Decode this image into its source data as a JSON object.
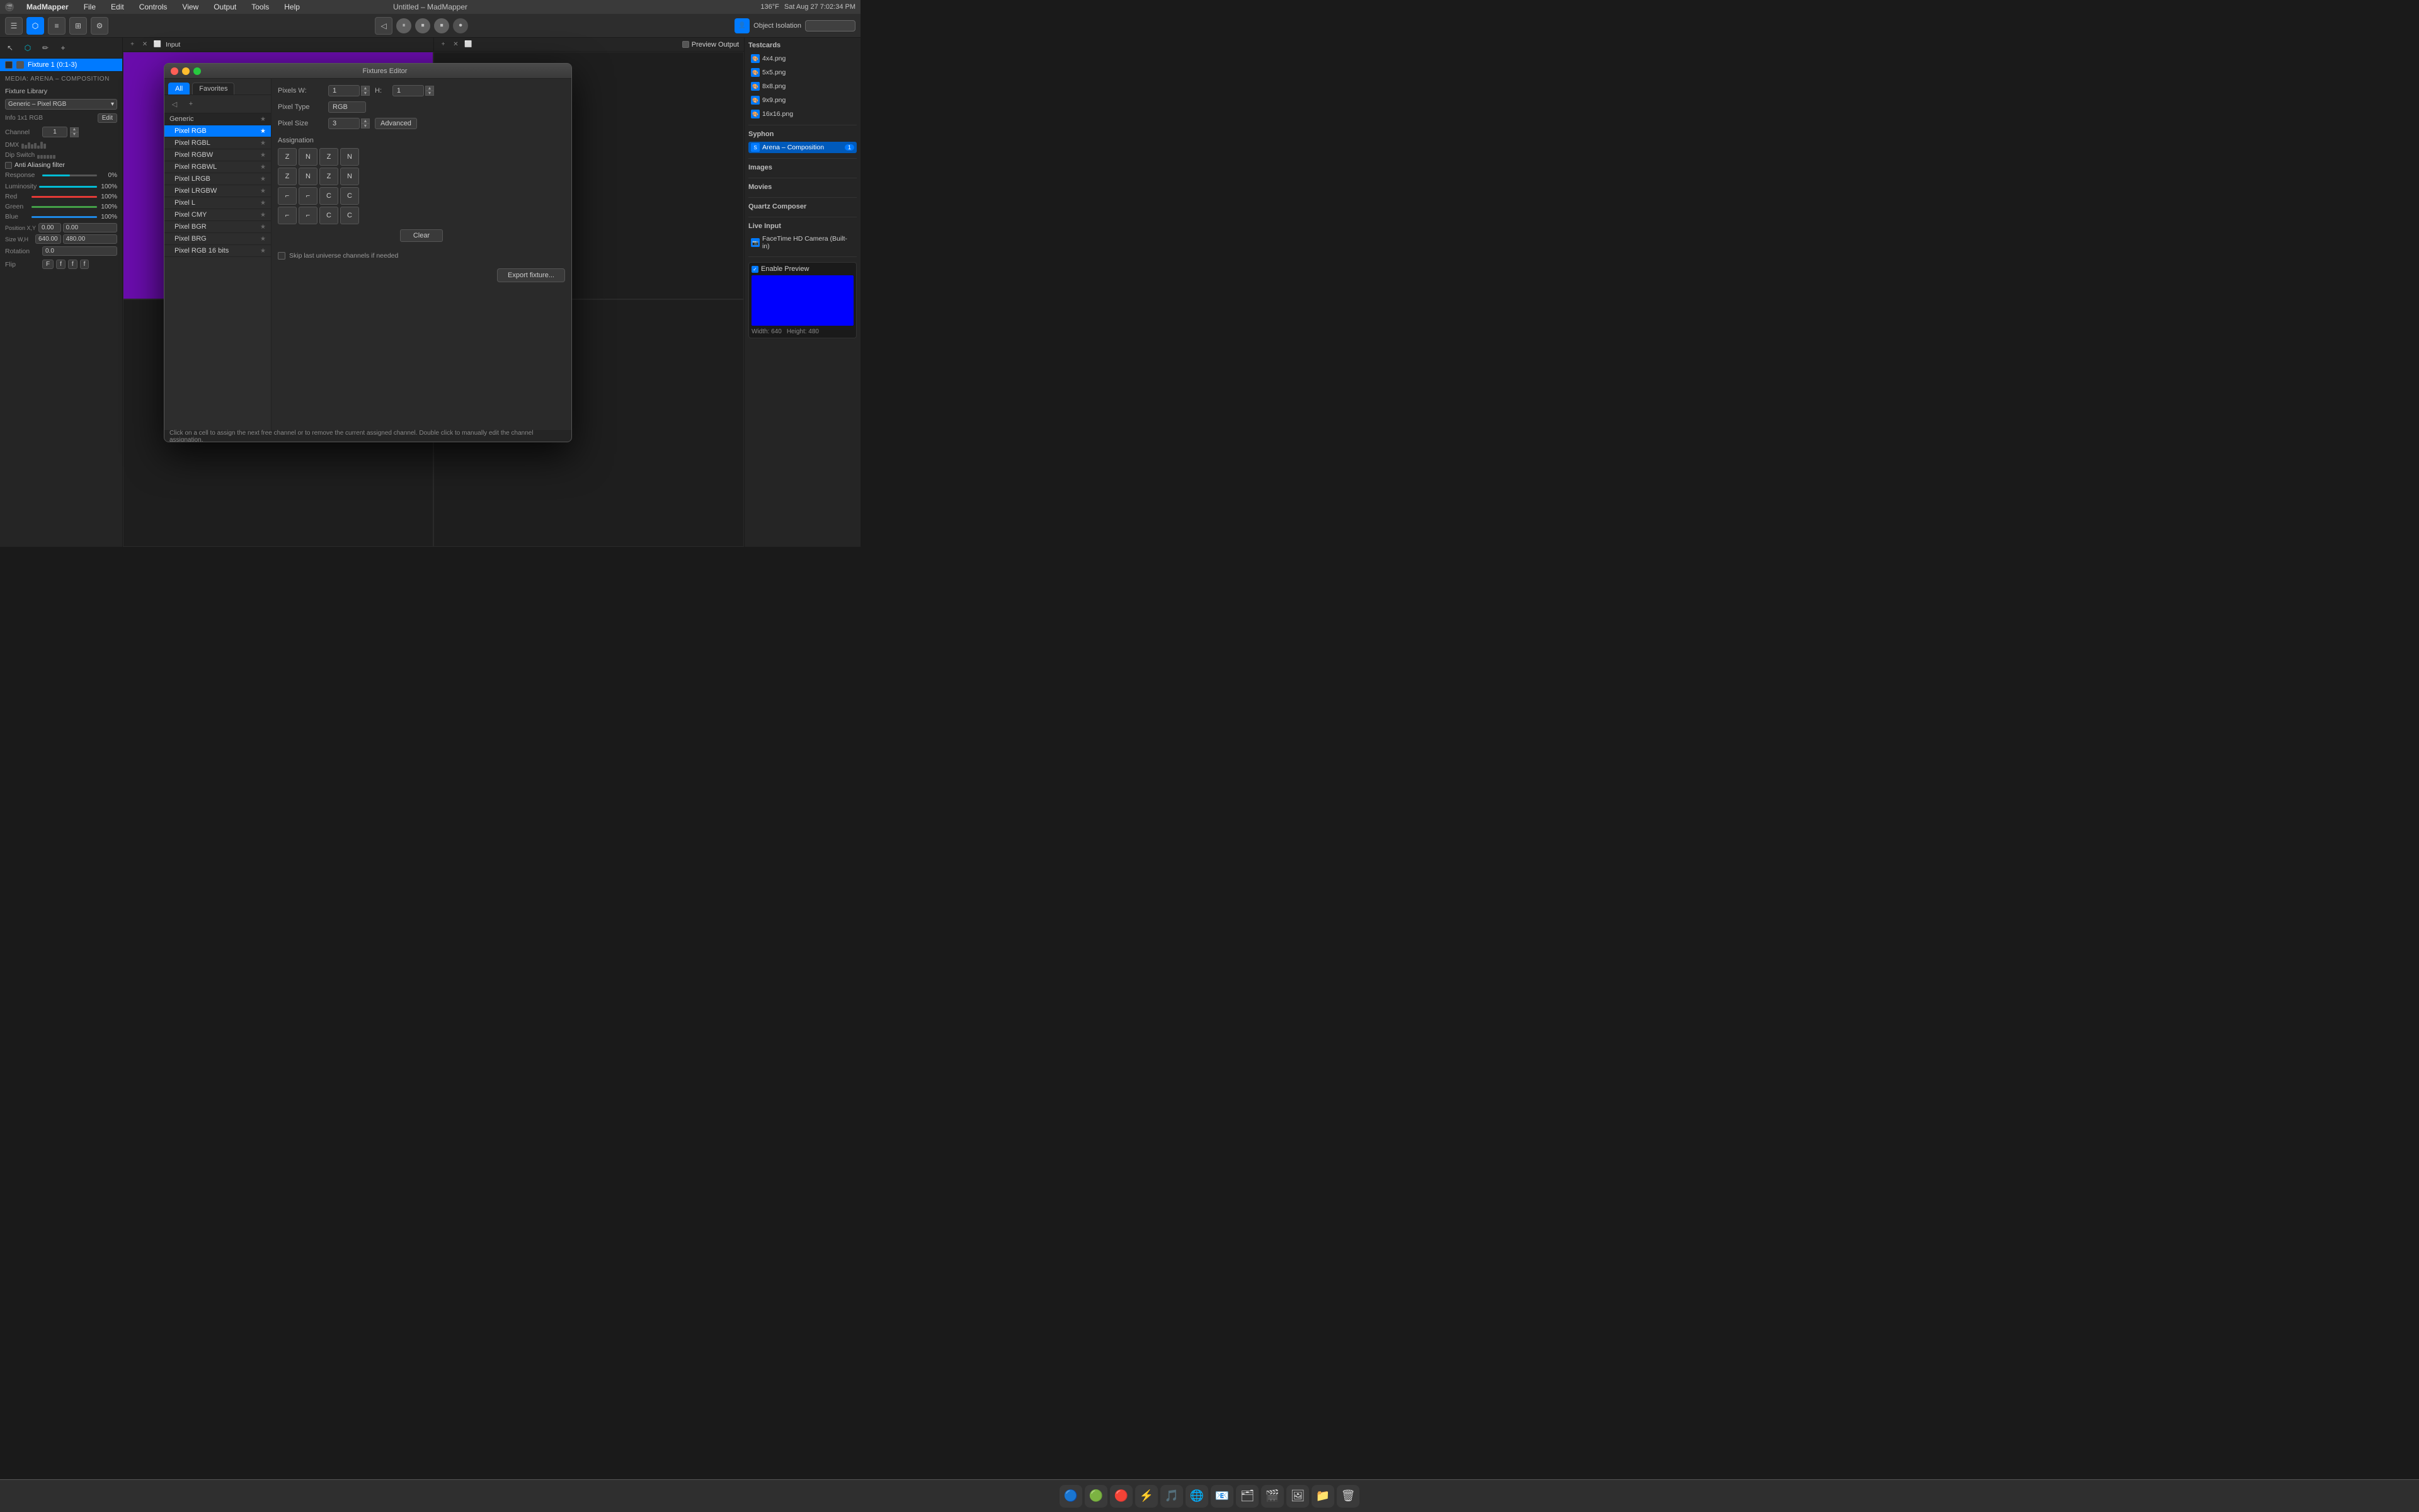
{
  "app": {
    "name": "MadMapper",
    "title": "Untitled – MadMapper",
    "version": "MadMapper"
  },
  "menubar": {
    "items": [
      "File",
      "Edit",
      "Controls",
      "View",
      "Output",
      "Tools",
      "Help"
    ],
    "clock": "Sat Aug 27  7:02:34 PM",
    "temp": "136°F"
  },
  "toolbar": {
    "transport": {
      "pause_label": "⏸",
      "stop1_label": "⏹",
      "stop2_label": "⏹",
      "record_label": "⏺"
    },
    "object_isolation": {
      "label": "Object Isolation",
      "value": ""
    }
  },
  "left_sidebar": {
    "fixture_item": {
      "name": "Fixture 1 (0:1-3)",
      "channel_range": "0:1-3"
    },
    "media_label": "Media: Arena – Composition",
    "fixture_library": {
      "label": "Fixture Library",
      "preset": "Generic – Pixel RGB",
      "info": "Info  1x1 RGB",
      "edit_label": "Edit"
    },
    "channel": {
      "label": "Channel",
      "value": "1"
    },
    "dmx_label": "DMX",
    "dip_switch_label": "Dip Switch",
    "anti_aliasing": "Anti Aliasing filter",
    "response": {
      "label": "Response",
      "value": "0%"
    },
    "luminosity": {
      "label": "Luminosity",
      "value": "100%"
    },
    "red": {
      "label": "Red",
      "value": "100%"
    },
    "green": {
      "label": "Green",
      "value": "100%"
    },
    "blue": {
      "label": "Blue",
      "value": "100%"
    },
    "position_xy": {
      "label": "Position X,Y",
      "x": "0.00",
      "y": "0.00"
    },
    "size_wh": {
      "label": "Size W,H",
      "w": "640.00",
      "h": "480.00"
    },
    "rotation": {
      "label": "Rotation",
      "value": "0.0"
    },
    "flip": {
      "label": "Flip",
      "f_label": "F",
      "b_label": "f",
      "v_label": "f",
      "h_label": "f"
    }
  },
  "content_area": {
    "input_label": "Input",
    "output_label": "Preview Output"
  },
  "right_sidebar": {
    "testcards_label": "Testcards",
    "testcards": [
      {
        "name": "4x4.png"
      },
      {
        "name": "5x5.png"
      },
      {
        "name": "8x8.png"
      },
      {
        "name": "9x9.png"
      },
      {
        "name": "16x16.png"
      }
    ],
    "syphon_label": "Syphon",
    "syphon_items": [
      {
        "name": "Arena – Composition",
        "highlighted": true,
        "badge": "1"
      }
    ],
    "images_label": "Images",
    "movies_label": "Movies",
    "quartz_label": "Quartz Composer",
    "live_input_label": "Live Input",
    "live_input_items": [
      {
        "name": "FaceTime HD Camera (Built-in)"
      }
    ],
    "enable_preview": "Enable Preview",
    "preview_width": "Width: 640",
    "preview_height": "Height: 480"
  },
  "fixtures_editor": {
    "title": "Fixtures Editor",
    "tabs": {
      "all": "All",
      "favorites": "Favorites"
    },
    "category": "Generic",
    "fixtures": [
      {
        "name": "Pixel RGB",
        "selected": true
      },
      {
        "name": "Pixel RGBL"
      },
      {
        "name": "Pixel RGBW"
      },
      {
        "name": "Pixel RGBWL"
      },
      {
        "name": "Pixel LRGB"
      },
      {
        "name": "Pixel LRGBW"
      },
      {
        "name": "Pixel L"
      },
      {
        "name": "Pixel CMY"
      },
      {
        "name": "Pixel BGR"
      },
      {
        "name": "Pixel BRG"
      },
      {
        "name": "Pixel RGB 16 bits"
      }
    ],
    "config": {
      "pixels_w_label": "Pixels W:",
      "pixels_w_value": "1",
      "pixels_h_label": "H:",
      "pixels_h_value": "1",
      "pixel_type_label": "Pixel Type",
      "pixel_type_value": "RGB",
      "pixel_size_label": "Pixel Size",
      "pixel_size_value": "3",
      "advanced_label": "Advanced"
    },
    "assignment_label": "Assignation",
    "assignment_cells": [
      [
        "Z",
        "N",
        "Z",
        "N"
      ],
      [
        "Z",
        "N",
        "Z",
        "N"
      ],
      [
        "⌐",
        "⌐",
        "C",
        "C"
      ],
      [
        "⌐",
        "⌐",
        "C",
        "C"
      ]
    ],
    "clear_label": "Clear",
    "skip_label": "Skip last universe channels if needed",
    "export_label": "Export fixture...",
    "status_text": "Click on a cell to assign the next free channel or to remove the current assigned channel. Double click to manually edit the channel assignation."
  }
}
